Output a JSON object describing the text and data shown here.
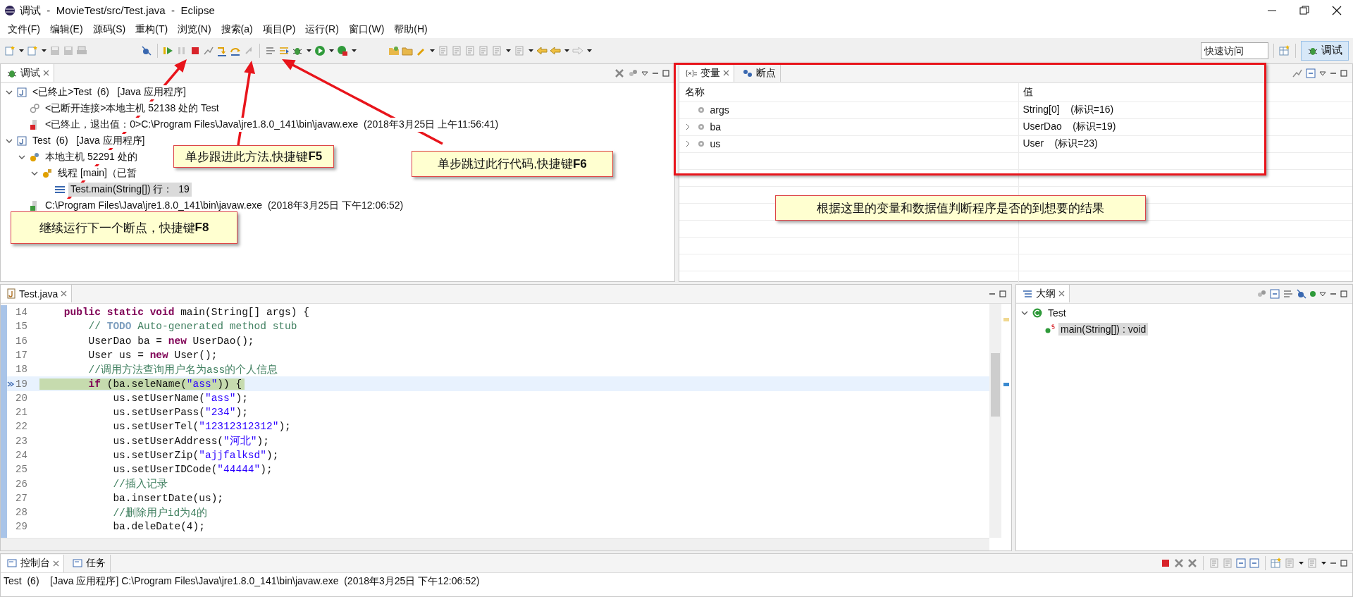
{
  "window": {
    "title": "调试  -  MovieTest/src/Test.java  -  Eclipse"
  },
  "menu": [
    "文件(F)",
    "编辑(E)",
    "源码(S)",
    "重构(T)",
    "浏览(N)",
    "搜索(a)",
    "项目(P)",
    "运行(R)",
    "窗口(W)",
    "帮助(H)"
  ],
  "quick_access": {
    "placeholder": "快速访问"
  },
  "perspectives": [
    {
      "label": "调试",
      "selected": true
    }
  ],
  "debug_view": {
    "tab": "调试",
    "tree": [
      {
        "label": "<已终止>Test  (6)   [Java 应用程序]",
        "kind": "app",
        "expanded": true,
        "selected": false,
        "children": [
          {
            "label": "<已断开连接>本地主机 52138 处的 Test",
            "kind": "vm",
            "selected": false
          },
          {
            "label": "<已终止，退出值：0>C:\\Program Files\\Java\\jre1.8.0_141\\bin\\javaw.exe  (2018年3月25日 上午11:56:41)",
            "kind": "process_done",
            "selected": false
          }
        ]
      },
      {
        "label": "Test  (6)   [Java 应用程序]",
        "kind": "app",
        "expanded": true,
        "selected": false,
        "children": [
          {
            "label": "本地主机 52291 处的",
            "kind": "vm_live",
            "expanded": true,
            "selected": false,
            "children": [
              {
                "label": "线程 [main]（已暂",
                "kind": "thread",
                "expanded": true,
                "selected": false,
                "children": [
                  {
                    "label": "Test.main(String[]) 行：  19",
                    "kind": "frame",
                    "selected": true
                  }
                ]
              }
            ]
          },
          {
            "label": "C:\\Program Files\\Java\\jre1.8.0_141\\bin\\javaw.exe  (2018年3月25日 下午12:06:52)",
            "kind": "process",
            "selected": false
          }
        ]
      }
    ]
  },
  "variables_view": {
    "tabs": [
      {
        "label": "变量",
        "selected": true
      },
      {
        "label": "断点",
        "selected": false
      }
    ],
    "columns": [
      "名称",
      "值"
    ],
    "rows": [
      {
        "name": "args",
        "value": "String[0]    (标识=16)",
        "expandable": false
      },
      {
        "name": "ba",
        "value": "UserDao    (标识=19)",
        "expandable": true
      },
      {
        "name": "us",
        "value": "User    (标识=23)",
        "expandable": true
      }
    ]
  },
  "editor": {
    "tab": "Test.java",
    "lines": [
      {
        "number": "14",
        "current": false,
        "tokens": [
          {
            "kind": "keyword",
            "text": "    public static void"
          },
          {
            "kind": "plain",
            "text": " main(String[] args) {"
          }
        ]
      },
      {
        "number": "15",
        "current": false,
        "tokens": [
          {
            "kind": "comment",
            "text": "        // "
          },
          {
            "kind": "todo",
            "text": "TODO"
          },
          {
            "kind": "comment",
            "text": " Auto-generated method stub"
          }
        ]
      },
      {
        "number": "16",
        "current": false,
        "tokens": [
          {
            "kind": "plain",
            "text": "        UserDao ba = "
          },
          {
            "kind": "keyword",
            "text": "new"
          },
          {
            "kind": "plain",
            "text": " UserDao();"
          }
        ]
      },
      {
        "number": "17",
        "current": false,
        "tokens": [
          {
            "kind": "plain",
            "text": "        User us = "
          },
          {
            "kind": "keyword",
            "text": "new"
          },
          {
            "kind": "plain",
            "text": " User();"
          }
        ]
      },
      {
        "number": "18",
        "current": false,
        "tokens": [
          {
            "kind": "comment",
            "text": "        //调用方法查询用户名为ass的个人信息"
          }
        ]
      },
      {
        "number": "19",
        "current": true,
        "tokens": [
          {
            "kind": "keyword",
            "text": "        if"
          },
          {
            "kind": "plain",
            "text": " (ba.seleName("
          },
          {
            "kind": "string",
            "text": "\"ass\""
          },
          {
            "kind": "plain",
            "text": ")) {"
          }
        ]
      },
      {
        "number": "20",
        "current": false,
        "tokens": [
          {
            "kind": "plain",
            "text": "            us.setUserName("
          },
          {
            "kind": "string",
            "text": "\"ass\""
          },
          {
            "kind": "plain",
            "text": ");"
          }
        ]
      },
      {
        "number": "21",
        "current": false,
        "tokens": [
          {
            "kind": "plain",
            "text": "            us.setUserPass("
          },
          {
            "kind": "string",
            "text": "\"234\""
          },
          {
            "kind": "plain",
            "text": ");"
          }
        ]
      },
      {
        "number": "22",
        "current": false,
        "tokens": [
          {
            "kind": "plain",
            "text": "            us.setUserTel("
          },
          {
            "kind": "string",
            "text": "\"12312312312\""
          },
          {
            "kind": "plain",
            "text": ");"
          }
        ]
      },
      {
        "number": "23",
        "current": false,
        "tokens": [
          {
            "kind": "plain",
            "text": "            us.setUserAddress("
          },
          {
            "kind": "string",
            "text": "\"河北\""
          },
          {
            "kind": "plain",
            "text": ");"
          }
        ]
      },
      {
        "number": "24",
        "current": false,
        "tokens": [
          {
            "kind": "plain",
            "text": "            us.setUserZip("
          },
          {
            "kind": "string",
            "text": "\"ajjfalksd\""
          },
          {
            "kind": "plain",
            "text": ");"
          }
        ]
      },
      {
        "number": "25",
        "current": false,
        "tokens": [
          {
            "kind": "plain",
            "text": "            us.setUserIDCode("
          },
          {
            "kind": "string",
            "text": "\"44444\""
          },
          {
            "kind": "plain",
            "text": ");"
          }
        ]
      },
      {
        "number": "26",
        "current": false,
        "tokens": [
          {
            "kind": "comment",
            "text": "            //插入记录"
          }
        ]
      },
      {
        "number": "27",
        "current": false,
        "tokens": [
          {
            "kind": "plain",
            "text": "            ba.insertDate(us);"
          }
        ]
      },
      {
        "number": "28",
        "current": false,
        "tokens": [
          {
            "kind": "comment",
            "text": "            //删除用户id为4的"
          }
        ]
      },
      {
        "number": "29",
        "current": false,
        "tokens": [
          {
            "kind": "plain",
            "text": "            ba.deleDate(4);"
          }
        ]
      }
    ]
  },
  "outline": {
    "tab": "大纲",
    "tree": [
      {
        "label": "Test",
        "kind": "class",
        "expanded": true,
        "selected": false,
        "children": [
          {
            "label": "main(String[]) : void",
            "kind": "method",
            "selected": true
          }
        ]
      }
    ]
  },
  "console": {
    "tabs": [
      {
        "label": "控制台",
        "selected": true
      },
      {
        "label": "任务",
        "selected": false
      }
    ],
    "text": "Test  (6)    [Java 应用程序] C:\\Program Files\\Java\\jre1.8.0_141\\bin\\javaw.exe  (2018年3月25日 下午12:06:52)"
  },
  "annotations": [
    {
      "text": "继续运行下一个断点，快捷键**F8**"
    },
    {
      "text": "单步跟进此方法,快捷键**F5**"
    },
    {
      "text": "单步跳过此行代码,快捷键**F6**"
    },
    {
      "text": "根据这里的变量和数据值判断程序是否的到想要的结果"
    }
  ]
}
